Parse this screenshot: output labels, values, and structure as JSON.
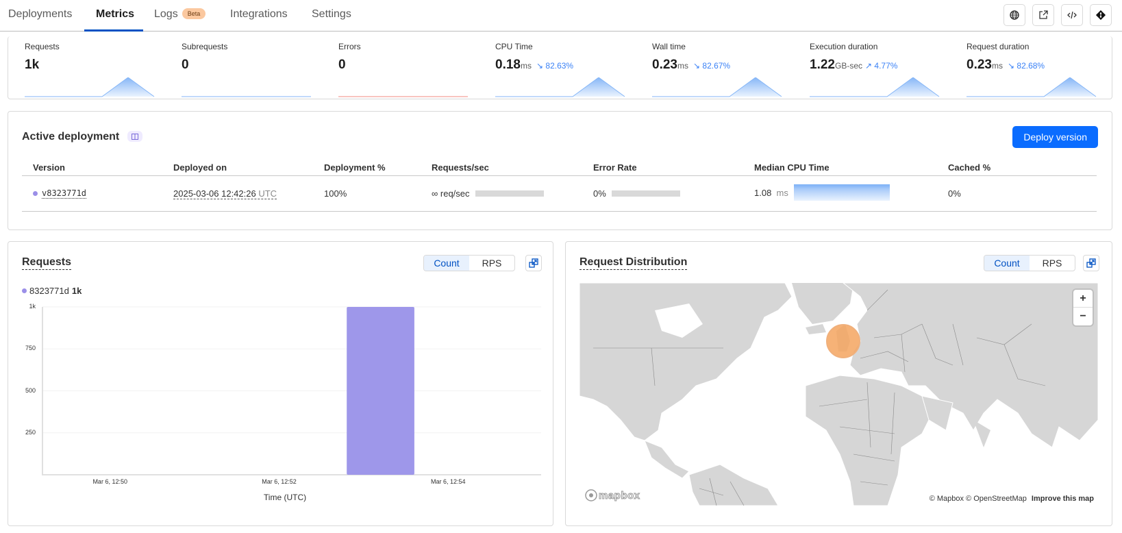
{
  "nav": {
    "tabs": [
      {
        "label": "Deployments",
        "active": false
      },
      {
        "label": "Metrics",
        "active": true
      },
      {
        "label": "Logs",
        "active": false,
        "badge": "Beta"
      },
      {
        "label": "Integrations",
        "active": false
      },
      {
        "label": "Settings",
        "active": false
      }
    ],
    "actions": [
      "globe-icon",
      "external-link-icon",
      "code-icon",
      "git-icon"
    ]
  },
  "metrics": [
    {
      "label": "Requests",
      "value": "1k",
      "unit": "",
      "delta": "",
      "trend": "",
      "color": "#86b6f7"
    },
    {
      "label": "Subrequests",
      "value": "0",
      "unit": "",
      "delta": "",
      "trend": "",
      "color": "#86b6f7"
    },
    {
      "label": "Errors",
      "value": "0",
      "unit": "",
      "delta": "",
      "trend": "",
      "color": "#f28b82"
    },
    {
      "label": "CPU Time",
      "value": "0.18",
      "unit": "ms",
      "delta": "82.63%",
      "trend": "down",
      "color": "#86b6f7"
    },
    {
      "label": "Wall time",
      "value": "0.23",
      "unit": "ms",
      "delta": "82.67%",
      "trend": "down",
      "color": "#86b6f7"
    },
    {
      "label": "Execution duration",
      "value": "1.22",
      "unit": "GB-sec",
      "delta": "4.77%",
      "trend": "up",
      "color": "#86b6f7"
    },
    {
      "label": "Request duration",
      "value": "0.23",
      "unit": "ms",
      "delta": "82.68%",
      "trend": "down",
      "color": "#86b6f7"
    }
  ],
  "deployment": {
    "title": "Active deployment",
    "deploy_button": "Deploy version",
    "columns": [
      "Version",
      "Deployed on",
      "Deployment %",
      "Requests/sec",
      "Error Rate",
      "Median CPU Time",
      "Cached %"
    ],
    "row": {
      "version": "v8323771d",
      "deployed_on": "2025-03-06 12:42:26",
      "deployed_tz": "UTC",
      "deployment_pct": "100%",
      "requests_sec": "∞ req/sec",
      "error_rate": "0%",
      "median_cpu": "1.08",
      "median_cpu_unit": "ms",
      "cached_pct": "0%"
    }
  },
  "requests_panel": {
    "title": "Requests",
    "toggle": [
      "Count",
      "RPS"
    ],
    "toggle_selected": "Count",
    "legend": {
      "name": "8323771d",
      "value": "1k",
      "color": "#9e97ea"
    }
  },
  "chart_data": {
    "type": "bar",
    "title": "Requests",
    "xlabel": "Time (UTC)",
    "ylabel": "",
    "x_ticks": [
      "Mar 6, 12:50",
      "Mar 6, 12:52",
      "Mar 6, 12:54"
    ],
    "y_ticks": [
      "250",
      "500",
      "750",
      "1k"
    ],
    "ylim": [
      0,
      1000
    ],
    "x_range_minutes": [
      12.0,
      15.0
    ],
    "series": [
      {
        "name": "8323771d",
        "color": "#9e97ea",
        "points": [
          {
            "x": "Mar 6, 12:53",
            "value": 1000
          }
        ]
      }
    ],
    "grid": true,
    "legend": "top-left"
  },
  "map_panel": {
    "title": "Request Distribution",
    "toggle": [
      "Count",
      "RPS"
    ],
    "toggle_selected": "Count",
    "zoom_in": "+",
    "zoom_out": "−",
    "logo": "mapbox",
    "attribution": "© Mapbox © OpenStreetMap",
    "improve_link": "Improve this map",
    "hotspot": {
      "region": "Western Europe",
      "color": "#f5a45f"
    }
  }
}
